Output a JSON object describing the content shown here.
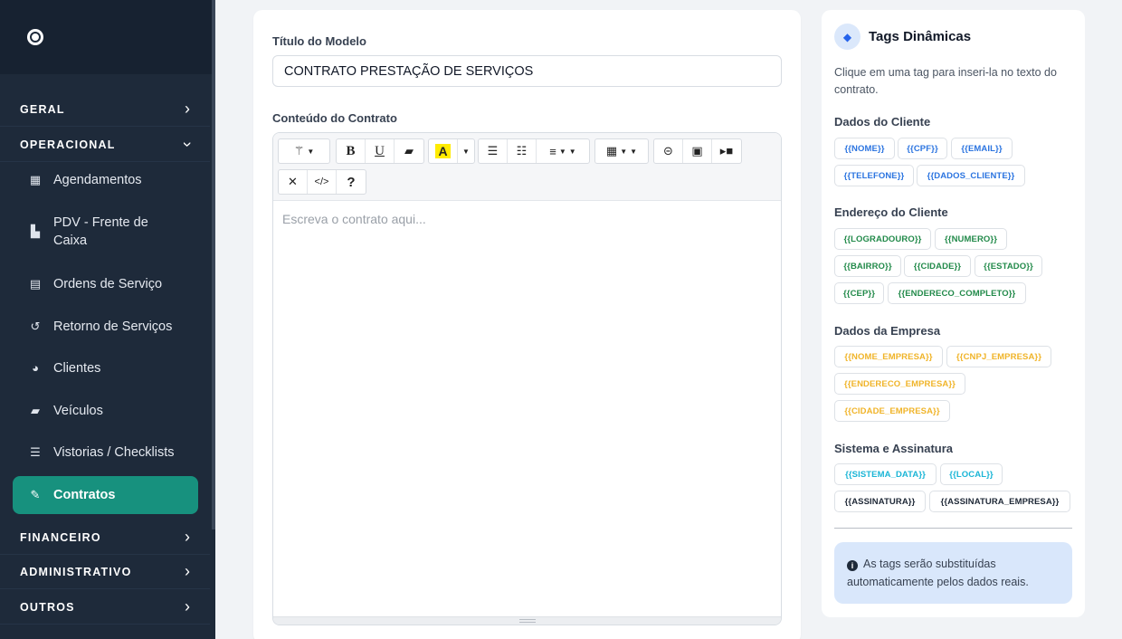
{
  "sidebar": {
    "sections": {
      "geral": "GERAL",
      "operacional": "OPERACIONAL",
      "financeiro": "FINANCEIRO",
      "administrativo": "ADMINISTRATIVO",
      "outros": "OUTROS"
    },
    "items": [
      {
        "label": "Agendamentos",
        "icon": "calendar-icon"
      },
      {
        "label": "PDV - Frente de Caixa",
        "icon": "cash-register-icon"
      },
      {
        "label": "Ordens de Serviço",
        "icon": "file-icon"
      },
      {
        "label": "Retorno de Serviços",
        "icon": "history-icon"
      },
      {
        "label": "Clientes",
        "icon": "users-icon"
      },
      {
        "label": "Veículos",
        "icon": "car-icon"
      },
      {
        "label": "Vistorias / Checklists",
        "icon": "checklist-icon"
      },
      {
        "label": "Contratos",
        "icon": "file-signature-icon",
        "active": true
      }
    ]
  },
  "form": {
    "title_label": "Título do Modelo",
    "title_value": "CONTRATO PRESTAÇÃO DE SERVIÇOS",
    "content_label": "Conteúdo do Contrato",
    "content_placeholder": "Escreva o contrato aqui..."
  },
  "tags": {
    "title": "Tags Dinâmicas",
    "description": "Clique em uma tag para inseri-la no texto do contrato.",
    "groups": [
      {
        "title": "Dados do Cliente",
        "color": "#2b74e0",
        "chips": [
          "{{NOME}}",
          "{{CPF}}",
          "{{EMAIL}}",
          "{{TELEFONE}}",
          "{{DADOS_CLIENTE}}"
        ]
      },
      {
        "title": "Endereço do Cliente",
        "color": "#228a4a",
        "chips": [
          "{{LOGRADOURO}}",
          "{{NUMERO}}",
          "{{BAIRRO}}",
          "{{CIDADE}}",
          "{{ESTADO}}",
          "{{CEP}}",
          "{{ENDERECO_COMPLETO}}"
        ]
      },
      {
        "title": "Dados da Empresa",
        "color": "#f0b429",
        "chips": [
          "{{NOME_EMPRESA}}",
          "{{CNPJ_EMPRESA}}",
          "{{ENDERECO_EMPRESA}}",
          "{{CIDADE_EMPRESA}}"
        ]
      },
      {
        "title": "Sistema e Assinatura",
        "color": "#1ab5d6",
        "chips": [
          "{{SISTEMA_DATA}}",
          "{{LOCAL}}",
          "{{ASSINATURA}}",
          "{{ASSINATURA_EMPRESA}}"
        ]
      }
    ],
    "info_text": "As tags serão substituídas automaticamente pelos dados reais."
  },
  "colors": {
    "sidebar_bg": "#1e2a3a",
    "active_item": "#17917e",
    "info_bg": "#d9e7fb"
  }
}
